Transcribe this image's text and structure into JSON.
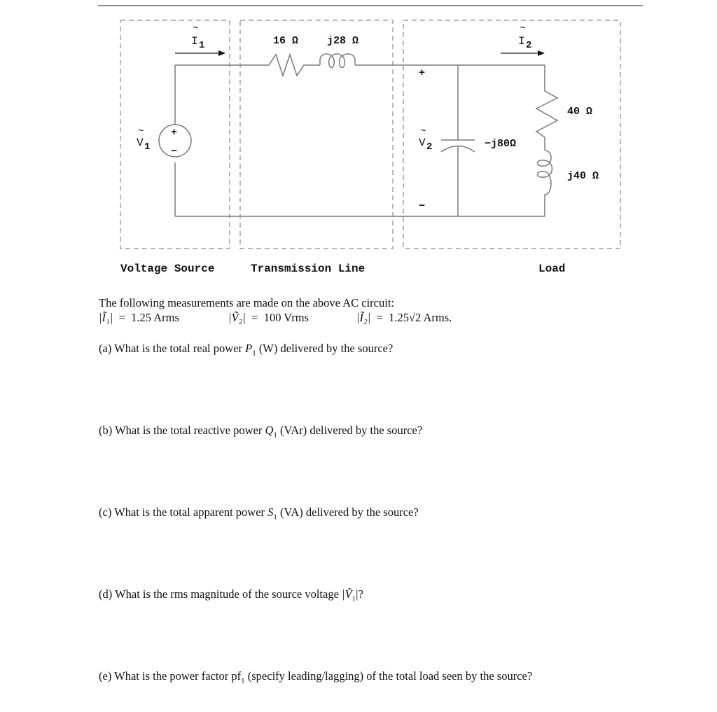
{
  "circuit": {
    "labels": {
      "i1": "I",
      "i1_sub": "1",
      "i2": "I",
      "i2_sub": "2",
      "v1": "V",
      "v1_sub": "1",
      "v2": "V",
      "v2_sub": "2",
      "tilde": "~",
      "plus": "+",
      "minus": "−"
    },
    "components": {
      "line_resistor": "16 Ω",
      "line_inductor": "j28 Ω",
      "capacitor": "−j80Ω",
      "load_resistor": "40 Ω",
      "load_inductor": "j40 Ω"
    },
    "sections": {
      "source": "Voltage Source",
      "line": "Transmission Line",
      "load": "Load"
    }
  },
  "intro": "The following measurements are made on the above AC circuit:",
  "measurements": [
    {
      "lhs": "|Ĩ₁|",
      "eq": "=",
      "rhs": "1.25 Arms"
    },
    {
      "lhs": "|Ṽ₂|",
      "eq": "=",
      "rhs": "100 Vrms"
    },
    {
      "lhs": "|Ĩ₂|",
      "eq": "=",
      "rhs": "1.25√2 Arms."
    }
  ],
  "questions": [
    {
      "label": "(a)",
      "text_before": "What is the total real power",
      "symbol": "P",
      "sub": "1",
      "text_after": "(W) delivered by the source?"
    },
    {
      "label": "(b)",
      "text_before": "What is the total reactive power",
      "symbol": "Q",
      "sub": "1",
      "text_after": "(VAr) delivered by the source?"
    },
    {
      "label": "(c)",
      "text_before": "What is the total apparent power",
      "symbol": "S",
      "sub": "1",
      "text_after": "(VA) delivered by the source?"
    },
    {
      "label": "(d)",
      "text_before": "What is the rms magnitude of the source voltage",
      "symbol": "|Ṽ",
      "sub": "1",
      "text_after": "|?"
    },
    {
      "label": "(e)",
      "text_before": "What is the power factor",
      "symbol": "pf",
      "sub": "1",
      "text_after": "(specify leading/lagging) of the total load seen by the source?"
    }
  ]
}
